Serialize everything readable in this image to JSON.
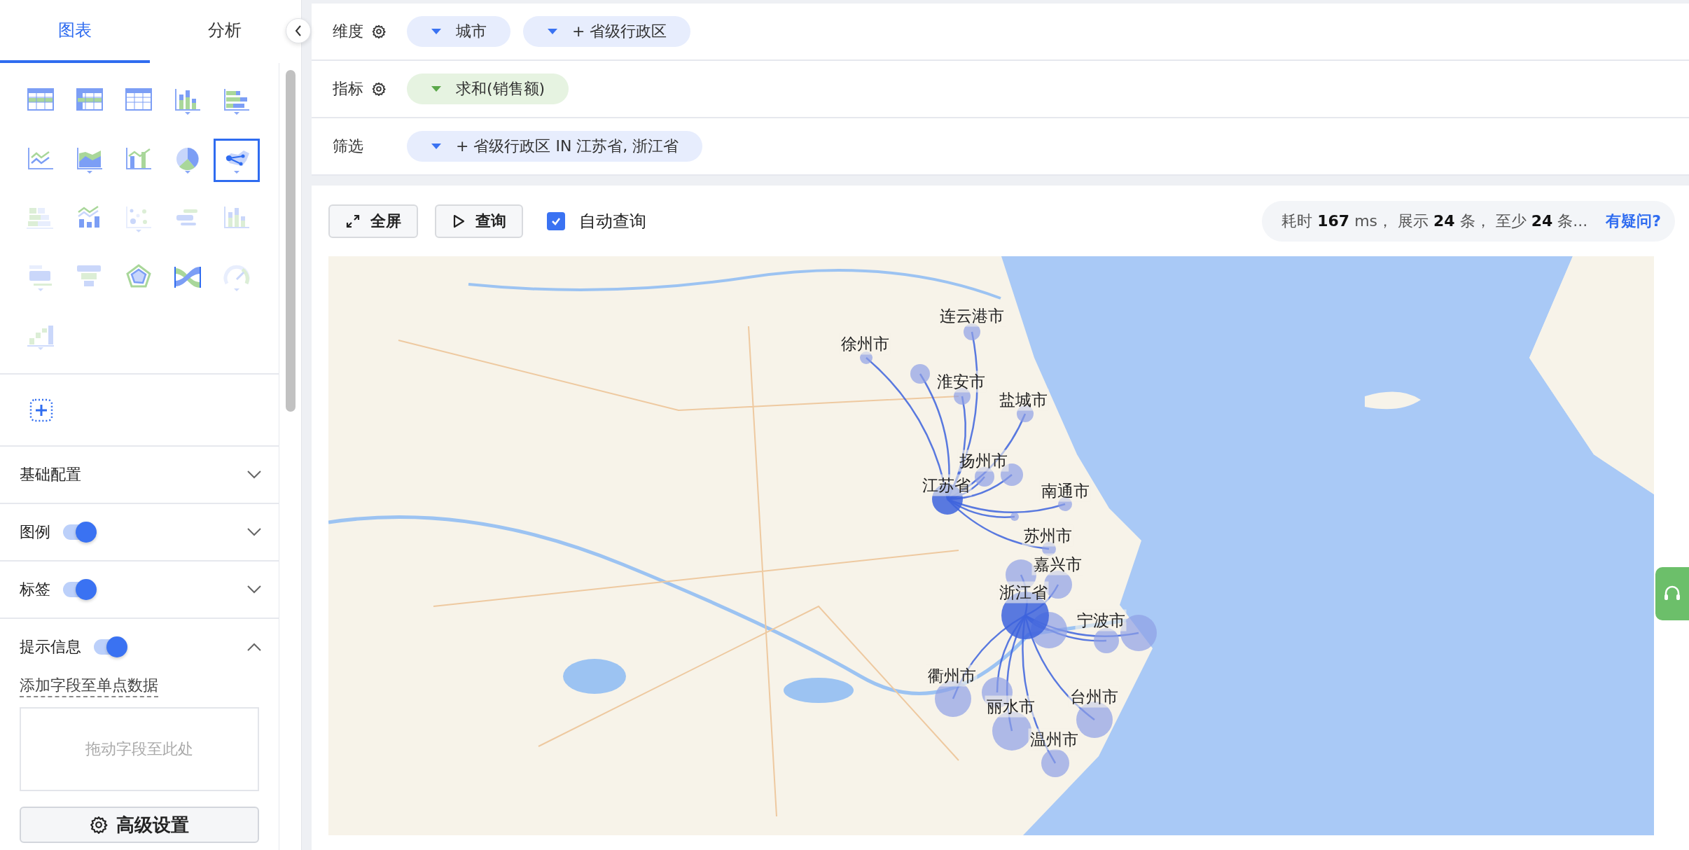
{
  "panel_tabs": [
    {
      "label": "图表",
      "selected": true
    },
    {
      "label": "分析",
      "selected": false
    }
  ],
  "chart_types": [
    {
      "kind": "table",
      "menu": false,
      "selected": false,
      "disabled": false
    },
    {
      "kind": "cross-table",
      "menu": false,
      "selected": false,
      "disabled": false
    },
    {
      "kind": "detail-table",
      "menu": false,
      "selected": false,
      "disabled": false
    },
    {
      "kind": "column",
      "menu": true,
      "selected": false,
      "disabled": false
    },
    {
      "kind": "bar",
      "menu": true,
      "selected": false,
      "disabled": false
    },
    {
      "kind": "line",
      "menu": false,
      "selected": false,
      "disabled": false
    },
    {
      "kind": "area",
      "menu": true,
      "selected": false,
      "disabled": false
    },
    {
      "kind": "combo",
      "menu": false,
      "selected": false,
      "disabled": false
    },
    {
      "kind": "pie",
      "menu": true,
      "selected": false,
      "disabled": false
    },
    {
      "kind": "flow-map",
      "menu": true,
      "selected": true,
      "disabled": false
    },
    {
      "kind": "stacked",
      "menu": false,
      "selected": false,
      "disabled": true
    },
    {
      "kind": "line-column",
      "menu": false,
      "selected": false,
      "disabled": false
    },
    {
      "kind": "scatter",
      "menu": true,
      "selected": false,
      "disabled": true
    },
    {
      "kind": "word-cloud",
      "menu": false,
      "selected": false,
      "disabled": true
    },
    {
      "kind": "histogram",
      "menu": false,
      "selected": false,
      "disabled": true
    },
    {
      "kind": "kpi",
      "menu": true,
      "selected": false,
      "disabled": true
    },
    {
      "kind": "funnel",
      "menu": false,
      "selected": false,
      "disabled": true
    },
    {
      "kind": "radar",
      "menu": false,
      "selected": false,
      "disabled": false
    },
    {
      "kind": "sankey",
      "menu": false,
      "selected": false,
      "disabled": false
    },
    {
      "kind": "gauge",
      "menu": true,
      "selected": false,
      "disabled": true
    },
    {
      "kind": "waterfall",
      "menu": true,
      "selected": false,
      "disabled": true
    }
  ],
  "sections": [
    {
      "title": "基础配置",
      "kind": "plain",
      "expanded": false
    },
    {
      "title": "图例",
      "kind": "toggle",
      "on": true,
      "expanded": false
    },
    {
      "title": "标签",
      "kind": "toggle",
      "on": true,
      "expanded": false
    },
    {
      "title": "提示信息",
      "kind": "toggle",
      "on": true,
      "expanded": true
    }
  ],
  "tooltip_field_label": "添加字段至单点数据",
  "drop_zone": {
    "placeholder": "拖动字段至此处"
  },
  "advanced_button": "高级设置",
  "shelves": [
    {
      "label": "维度",
      "settings": true,
      "pills": [
        {
          "text": "城市",
          "kind": "dimension"
        },
        {
          "text": "+ 省级行政区",
          "kind": "dimension"
        }
      ]
    },
    {
      "label": "指标",
      "settings": true,
      "pills": [
        {
          "text": "求和(销售额)",
          "kind": "measure"
        }
      ]
    },
    {
      "label": "筛选",
      "settings": false,
      "pills": [
        {
          "text": "+ 省级行政区 IN 江苏省, 浙江省",
          "kind": "dimension"
        }
      ]
    }
  ],
  "toolbar": {
    "fullscreen": "全屏",
    "query": "查询",
    "auto_query": {
      "label": "自动查询",
      "checked": true
    }
  },
  "stats": {
    "text": "耗时 **167** ms， 展示 **24** 条， 至少 **24** 条...",
    "help_link": "有疑问?"
  },
  "map_labels": [
    "连云港市",
    "徐州市",
    "淮安市",
    "盐城市",
    "扬州市",
    "江苏省",
    "南通市",
    "苏州市",
    "嘉兴市",
    "浙江省",
    "宁波市",
    "衢州市",
    "丽水市",
    "台州市",
    "温州市"
  ]
}
